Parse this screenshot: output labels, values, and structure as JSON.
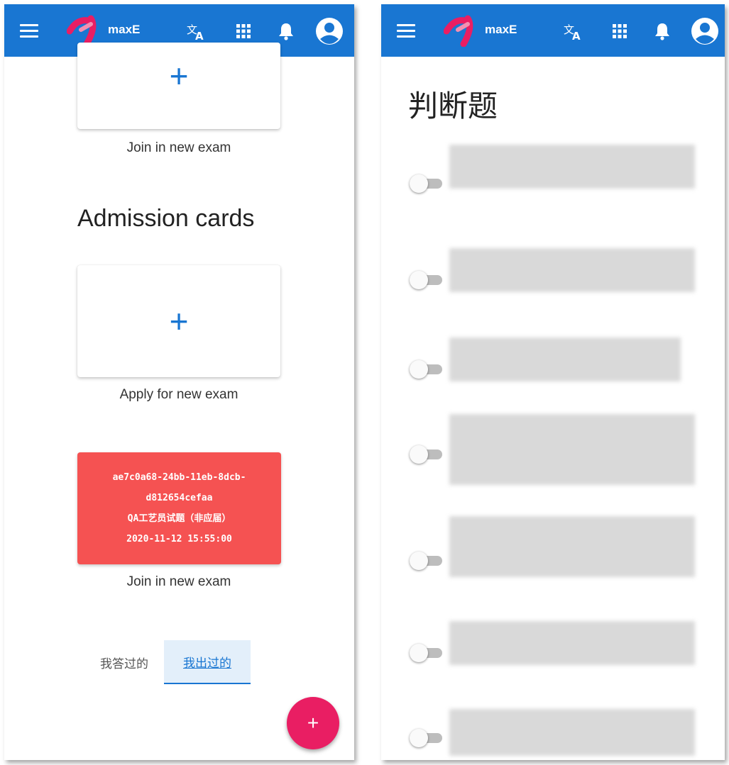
{
  "appbar": {
    "brand": "maxE"
  },
  "left": {
    "top_caption": "Join in new exam",
    "section_title": "Admission cards",
    "apply_caption": "Apply for new exam",
    "exam_card": {
      "line1": "ae7c0a68-24bb-11eb-8dcb-",
      "line2": "d812654cefaa",
      "line3": "QA工艺员试题（非应届）",
      "line4": "2020-11-12 15:55:00"
    },
    "exam_caption": "Join in new exam",
    "tabs": [
      "我答过的",
      "我出过的"
    ],
    "fab_label": "+"
  },
  "right": {
    "title": "判断题"
  },
  "colors": {
    "appbar": "#1976d2",
    "accent_blue": "#1976d2",
    "exam_card": "#f55252",
    "fab": "#e91e63"
  }
}
